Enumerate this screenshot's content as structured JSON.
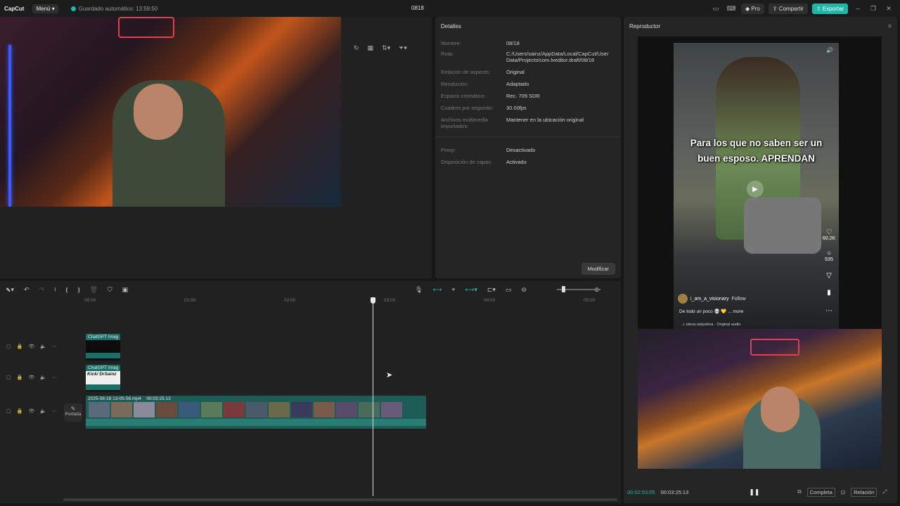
{
  "topbar": {
    "logo": "CapCut",
    "menu_label": "Menú",
    "autosave": "Guardado automático: 13:59:50",
    "project_title": "0818",
    "pro_label": "Pro",
    "share_label": "Compartir",
    "export_label": "Exportar"
  },
  "details": {
    "title": "Detalles",
    "rows": [
      {
        "k": "Nombre:",
        "v": "08/18"
      },
      {
        "k": "Ruta:",
        "v": "C:/Users/sainz/AppData/Local/CapCut/User Data/Projects/com.lveditor.draft/08/18"
      },
      {
        "k": "Relación de aspecto:",
        "v": "Original"
      },
      {
        "k": "Resolución:",
        "v": "Adaptado"
      },
      {
        "k": "Espacio cromático:",
        "v": "Rec. 709 SDR"
      },
      {
        "k": "Cuadros por segundo:",
        "v": "30.00fps"
      },
      {
        "k": "Archivos multimedia importados:",
        "v": "Mantener en la ubicación original"
      },
      {
        "k": "Proxy:",
        "v": "Desactivado"
      },
      {
        "k": "Disposición de capas:",
        "v": "Activado"
      }
    ],
    "modify_label": "Modificar"
  },
  "player": {
    "title": "Reproductor",
    "caption_line1": "Para los que no saben ser un",
    "caption_line2": "buen esposo. APRENDAN",
    "likes": "60.2K",
    "comments": "535",
    "username": "i_am_a_visionary",
    "follow": "Follow",
    "description": "De todo un poco 💀 💛 ... more",
    "audio": "♫ elena.radyukina · Original audio",
    "current_time": "00:02:53:05",
    "total_time": "00:03:25:13",
    "full_label": "Completa",
    "ratio_label": "Relación"
  },
  "timeline": {
    "ticks": [
      "00:00",
      "01:00",
      "02:00",
      "03:00",
      "04:00",
      "05:00"
    ],
    "clip1_label": "ChatGPT Imag",
    "clip2_label": "ChatGPT Imag",
    "clip2_text": "Kick/ DrSainz",
    "main_clip_label": "2025-08-18 13-05-56.mp4",
    "main_clip_duration": "00:03:25:13",
    "cover_label": "Portada"
  }
}
